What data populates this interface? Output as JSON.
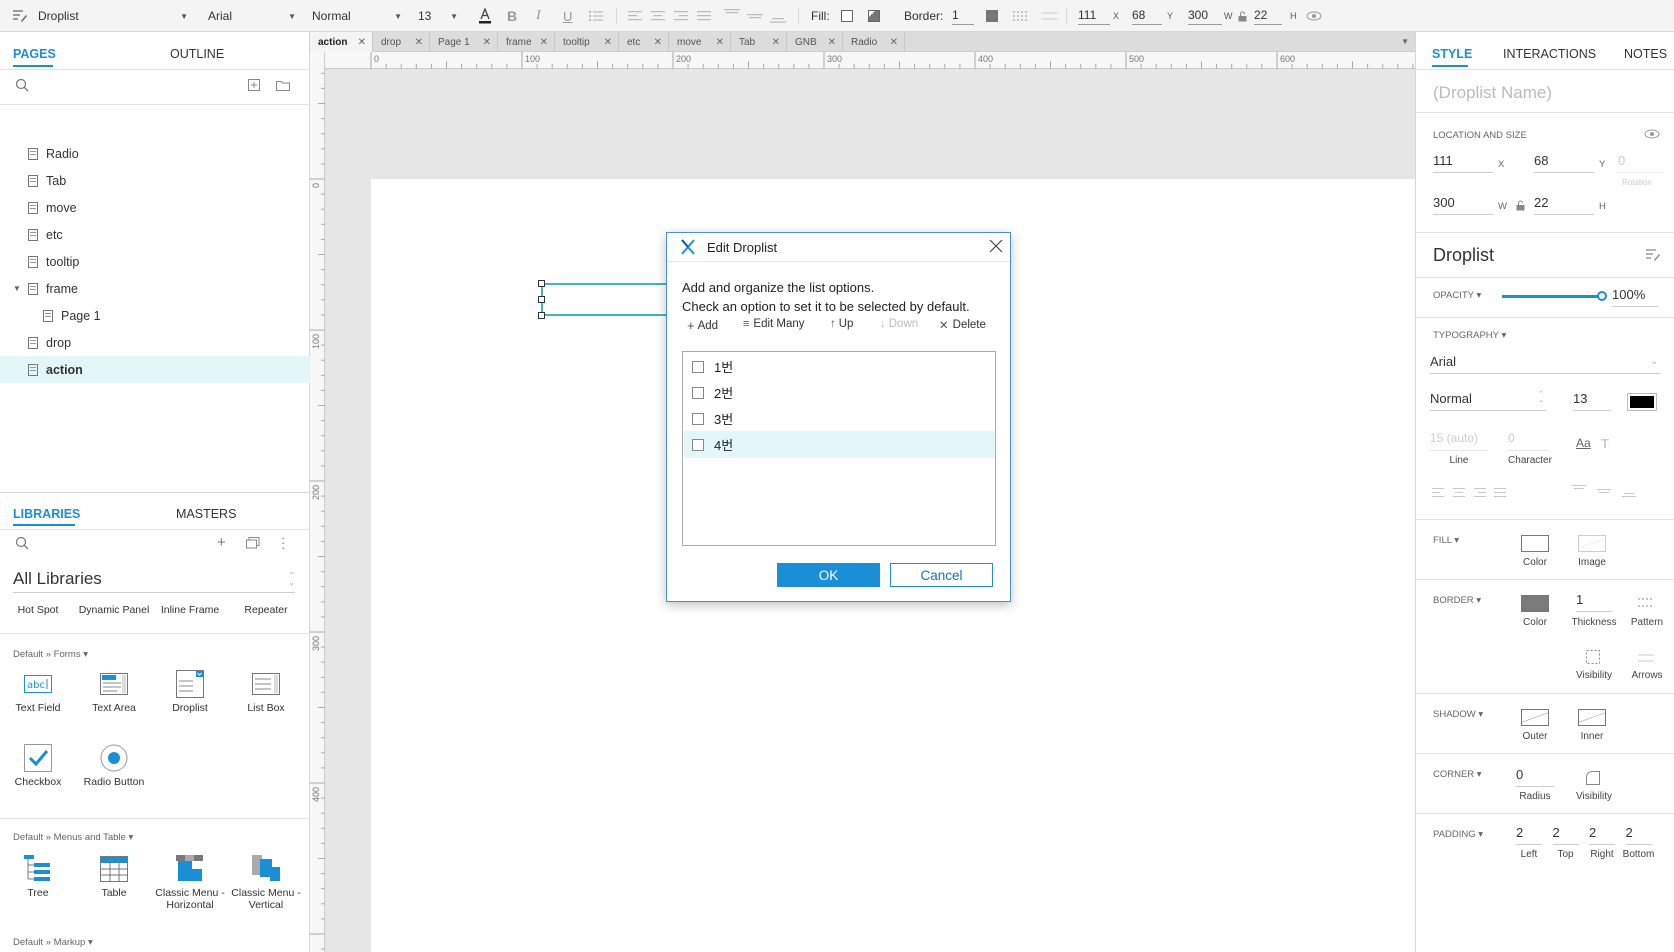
{
  "toolbar": {
    "widget_type": "Droplist",
    "font": "Arial",
    "style": "Normal",
    "size": "13",
    "fill_label": "Fill:",
    "border_label": "Border:",
    "border_value": "1",
    "x": "111",
    "x_label": "X",
    "y": "68",
    "y_label": "Y",
    "w": "300",
    "w_label": "W",
    "h": "22",
    "h_label": "H"
  },
  "left": {
    "tabs": [
      "PAGES",
      "OUTLINE"
    ],
    "pages": [
      {
        "label": "Radio",
        "indent": 0
      },
      {
        "label": "Tab",
        "indent": 0
      },
      {
        "label": "move",
        "indent": 0
      },
      {
        "label": "etc",
        "indent": 0
      },
      {
        "label": "tooltip",
        "indent": 0
      },
      {
        "label": "frame",
        "indent": 0
      },
      {
        "label": "Page 1",
        "indent": 1
      },
      {
        "label": "drop",
        "indent": 0
      },
      {
        "label": "action",
        "indent": 0
      }
    ],
    "lib_tabs": [
      "LIBRARIES",
      "MASTERS"
    ],
    "library_select": "All Libraries",
    "top_items": [
      "Hot Spot",
      "Dynamic Panel",
      "Inline Frame",
      "Repeater"
    ],
    "section_forms": "Default » Forms ▾",
    "forms": [
      "Text Field",
      "Text Area",
      "Droplist",
      "List Box",
      "Checkbox",
      "Radio Button"
    ],
    "section_menus": "Default » Menus and Table ▾",
    "menus": [
      "Tree",
      "Table",
      "Classic Menu - Horizontal",
      "Classic Menu - Vertical"
    ],
    "section_markup": "Default » Markup ▾"
  },
  "tabs": [
    "action",
    "drop",
    "Page 1",
    "frame",
    "tooltip",
    "etc",
    "move",
    "Tab",
    "GNB",
    "Radio"
  ],
  "ruler": {
    "h": [
      "0",
      "100",
      "200",
      "300",
      "400",
      "500",
      "600"
    ],
    "v": [
      "0",
      "100",
      "200",
      "300",
      "400"
    ]
  },
  "dialog": {
    "title": "Edit Droplist",
    "line1": "Add and organize the list options.",
    "line2": "Check an option to set it to be selected by default.",
    "add": "Add",
    "edit_many": "Edit Many",
    "up": "Up",
    "down": "Down",
    "delete": "Delete",
    "options": [
      "1번",
      "2번",
      "3번",
      "4번"
    ],
    "ok": "OK",
    "cancel": "Cancel"
  },
  "right": {
    "tabs": [
      "STYLE",
      "INTERACTIONS",
      "NOTES"
    ],
    "name_placeholder": "(Droplist Name)",
    "location_label": "LOCATION AND SIZE",
    "x": "111",
    "x_label": "X",
    "y": "68",
    "y_label": "Y",
    "rotation": "0",
    "rotation_label": "Rotation",
    "w": "300",
    "w_label": "W",
    "h": "22",
    "h_label": "H",
    "widget_name": "Droplist",
    "opacity_label": "OPACITY ▾",
    "opacity": "100%",
    "opacity_value": 1.0,
    "typography_label": "TYPOGRAPHY ▾",
    "font": "Arial",
    "style": "Normal",
    "size": "13",
    "line": "15 (auto)",
    "line_label": "Line",
    "character": "0",
    "character_label": "Character",
    "fill_label": "FILL ▾",
    "fill_color": "Color",
    "fill_image": "Image",
    "border_label": "BORDER ▾",
    "border_color": "Color",
    "thickness": "1",
    "thickness_label": "Thickness",
    "pattern": "Pattern",
    "visibility": "Visibility",
    "arrows": "Arrows",
    "shadow_label": "SHADOW ▾",
    "outer": "Outer",
    "inner": "Inner",
    "corner_label": "CORNER ▾",
    "radius": "0",
    "radius_label": "Radius",
    "corner_visibility": "Visibility",
    "padding_label": "PADDING ▾",
    "padding": [
      {
        "v": "2",
        "l": "Left"
      },
      {
        "v": "2",
        "l": "Top"
      },
      {
        "v": "2",
        "l": "Right"
      },
      {
        "v": "2",
        "l": "Bottom"
      }
    ]
  },
  "colors": {
    "accent": "#1a8fd8",
    "selected_row": "#e3f6f8",
    "text_color_swatch": "#000000"
  }
}
